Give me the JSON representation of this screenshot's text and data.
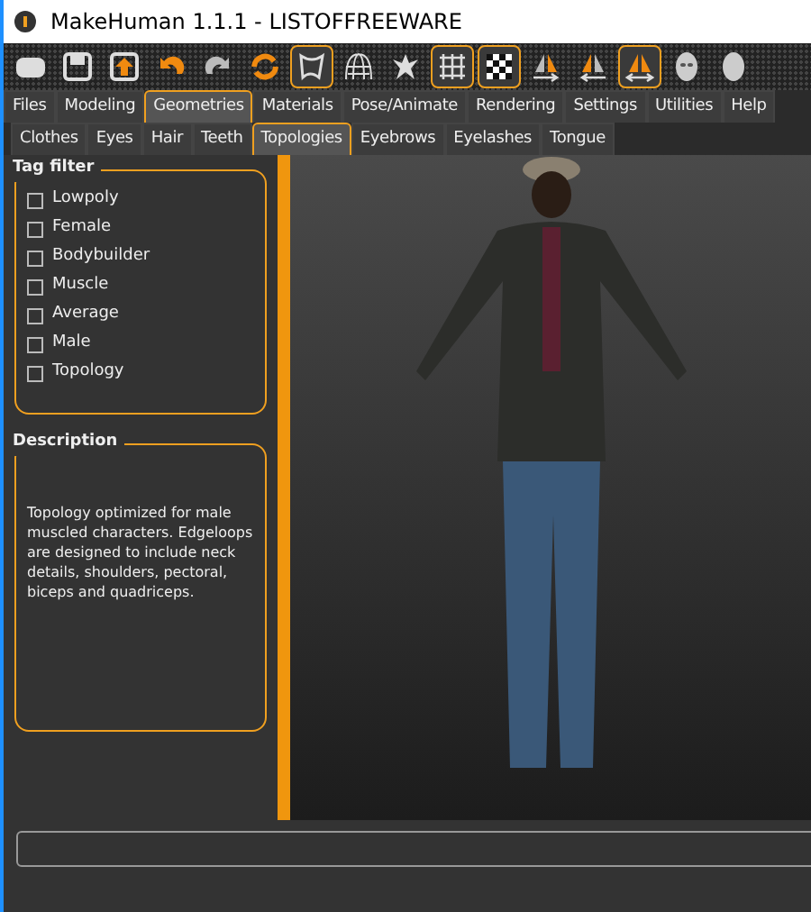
{
  "window": {
    "title": "MakeHuman 1.1.1 - LISTOFFREEWARE"
  },
  "toolbar": [
    {
      "kind": "blank",
      "on": false
    },
    {
      "kind": "save",
      "on": false
    },
    {
      "kind": "export",
      "on": false
    },
    {
      "kind": "undo",
      "on": false
    },
    {
      "kind": "redo",
      "on": false
    },
    {
      "kind": "reset",
      "on": false
    },
    {
      "kind": "smooth",
      "on": true
    },
    {
      "kind": "wireframe",
      "on": false
    },
    {
      "kind": "pose",
      "on": false
    },
    {
      "kind": "grid",
      "on": true
    },
    {
      "kind": "checker",
      "on": true
    },
    {
      "kind": "sym-right",
      "on": false
    },
    {
      "kind": "sym-left",
      "on": false
    },
    {
      "kind": "sym-both",
      "on": true
    },
    {
      "kind": "face",
      "on": false
    },
    {
      "kind": "head",
      "on": false
    }
  ],
  "main_tabs": [
    {
      "label": "Files",
      "selected": false
    },
    {
      "label": "Modeling",
      "selected": false
    },
    {
      "label": "Geometries",
      "selected": true
    },
    {
      "label": "Materials",
      "selected": false
    },
    {
      "label": "Pose/Animate",
      "selected": false
    },
    {
      "label": "Rendering",
      "selected": false
    },
    {
      "label": "Settings",
      "selected": false
    },
    {
      "label": "Utilities",
      "selected": false
    },
    {
      "label": "Help",
      "selected": false
    }
  ],
  "sub_tabs": [
    {
      "label": "Clothes",
      "selected": false
    },
    {
      "label": "Eyes",
      "selected": false
    },
    {
      "label": "Hair",
      "selected": false
    },
    {
      "label": "Teeth",
      "selected": false
    },
    {
      "label": "Topologies",
      "selected": true
    },
    {
      "label": "Eyebrows",
      "selected": false
    },
    {
      "label": "Eyelashes",
      "selected": false
    },
    {
      "label": "Tongue",
      "selected": false
    }
  ],
  "tag_filter": {
    "title": "Tag filter",
    "items": [
      {
        "label": "Lowpoly",
        "checked": false
      },
      {
        "label": "Female",
        "checked": false
      },
      {
        "label": "Bodybuilder",
        "checked": false
      },
      {
        "label": "Muscle",
        "checked": false
      },
      {
        "label": "Average",
        "checked": false
      },
      {
        "label": "Male",
        "checked": false
      },
      {
        "label": "Topology",
        "checked": false
      }
    ]
  },
  "description": {
    "title": "Description",
    "text": "Topology optimized for male muscled characters. Edgeloops are designed to include neck details, shoulders, pectoral, biceps and quadriceps."
  }
}
